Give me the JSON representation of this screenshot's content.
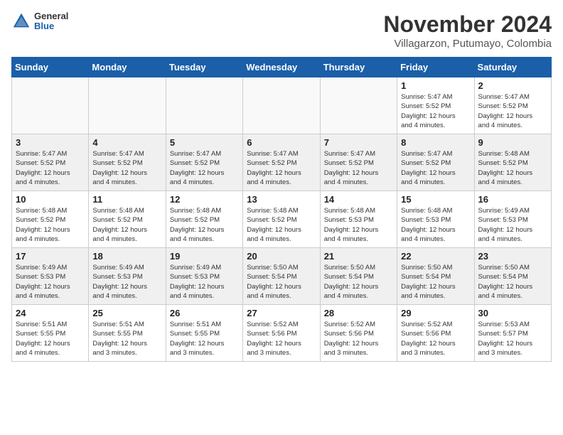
{
  "header": {
    "logo": {
      "general": "General",
      "blue": "Blue"
    },
    "title": "November 2024",
    "subtitle": "Villagarzon, Putumayo, Colombia"
  },
  "days_of_week": [
    "Sunday",
    "Monday",
    "Tuesday",
    "Wednesday",
    "Thursday",
    "Friday",
    "Saturday"
  ],
  "weeks": [
    {
      "days": [
        {
          "num": "",
          "info": "",
          "empty": true
        },
        {
          "num": "",
          "info": "",
          "empty": true
        },
        {
          "num": "",
          "info": "",
          "empty": true
        },
        {
          "num": "",
          "info": "",
          "empty": true
        },
        {
          "num": "",
          "info": "",
          "empty": true
        },
        {
          "num": "1",
          "info": "Sunrise: 5:47 AM\nSunset: 5:52 PM\nDaylight: 12 hours\nand 4 minutes."
        },
        {
          "num": "2",
          "info": "Sunrise: 5:47 AM\nSunset: 5:52 PM\nDaylight: 12 hours\nand 4 minutes."
        }
      ]
    },
    {
      "days": [
        {
          "num": "3",
          "info": "Sunrise: 5:47 AM\nSunset: 5:52 PM\nDaylight: 12 hours\nand 4 minutes."
        },
        {
          "num": "4",
          "info": "Sunrise: 5:47 AM\nSunset: 5:52 PM\nDaylight: 12 hours\nand 4 minutes."
        },
        {
          "num": "5",
          "info": "Sunrise: 5:47 AM\nSunset: 5:52 PM\nDaylight: 12 hours\nand 4 minutes."
        },
        {
          "num": "6",
          "info": "Sunrise: 5:47 AM\nSunset: 5:52 PM\nDaylight: 12 hours\nand 4 minutes."
        },
        {
          "num": "7",
          "info": "Sunrise: 5:47 AM\nSunset: 5:52 PM\nDaylight: 12 hours\nand 4 minutes."
        },
        {
          "num": "8",
          "info": "Sunrise: 5:47 AM\nSunset: 5:52 PM\nDaylight: 12 hours\nand 4 minutes."
        },
        {
          "num": "9",
          "info": "Sunrise: 5:48 AM\nSunset: 5:52 PM\nDaylight: 12 hours\nand 4 minutes."
        }
      ]
    },
    {
      "days": [
        {
          "num": "10",
          "info": "Sunrise: 5:48 AM\nSunset: 5:52 PM\nDaylight: 12 hours\nand 4 minutes."
        },
        {
          "num": "11",
          "info": "Sunrise: 5:48 AM\nSunset: 5:52 PM\nDaylight: 12 hours\nand 4 minutes."
        },
        {
          "num": "12",
          "info": "Sunrise: 5:48 AM\nSunset: 5:52 PM\nDaylight: 12 hours\nand 4 minutes."
        },
        {
          "num": "13",
          "info": "Sunrise: 5:48 AM\nSunset: 5:52 PM\nDaylight: 12 hours\nand 4 minutes."
        },
        {
          "num": "14",
          "info": "Sunrise: 5:48 AM\nSunset: 5:53 PM\nDaylight: 12 hours\nand 4 minutes."
        },
        {
          "num": "15",
          "info": "Sunrise: 5:48 AM\nSunset: 5:53 PM\nDaylight: 12 hours\nand 4 minutes."
        },
        {
          "num": "16",
          "info": "Sunrise: 5:49 AM\nSunset: 5:53 PM\nDaylight: 12 hours\nand 4 minutes."
        }
      ]
    },
    {
      "days": [
        {
          "num": "17",
          "info": "Sunrise: 5:49 AM\nSunset: 5:53 PM\nDaylight: 12 hours\nand 4 minutes."
        },
        {
          "num": "18",
          "info": "Sunrise: 5:49 AM\nSunset: 5:53 PM\nDaylight: 12 hours\nand 4 minutes."
        },
        {
          "num": "19",
          "info": "Sunrise: 5:49 AM\nSunset: 5:53 PM\nDaylight: 12 hours\nand 4 minutes."
        },
        {
          "num": "20",
          "info": "Sunrise: 5:50 AM\nSunset: 5:54 PM\nDaylight: 12 hours\nand 4 minutes."
        },
        {
          "num": "21",
          "info": "Sunrise: 5:50 AM\nSunset: 5:54 PM\nDaylight: 12 hours\nand 4 minutes."
        },
        {
          "num": "22",
          "info": "Sunrise: 5:50 AM\nSunset: 5:54 PM\nDaylight: 12 hours\nand 4 minutes."
        },
        {
          "num": "23",
          "info": "Sunrise: 5:50 AM\nSunset: 5:54 PM\nDaylight: 12 hours\nand 4 minutes."
        }
      ]
    },
    {
      "days": [
        {
          "num": "24",
          "info": "Sunrise: 5:51 AM\nSunset: 5:55 PM\nDaylight: 12 hours\nand 4 minutes."
        },
        {
          "num": "25",
          "info": "Sunrise: 5:51 AM\nSunset: 5:55 PM\nDaylight: 12 hours\nand 3 minutes."
        },
        {
          "num": "26",
          "info": "Sunrise: 5:51 AM\nSunset: 5:55 PM\nDaylight: 12 hours\nand 3 minutes."
        },
        {
          "num": "27",
          "info": "Sunrise: 5:52 AM\nSunset: 5:56 PM\nDaylight: 12 hours\nand 3 minutes."
        },
        {
          "num": "28",
          "info": "Sunrise: 5:52 AM\nSunset: 5:56 PM\nDaylight: 12 hours\nand 3 minutes."
        },
        {
          "num": "29",
          "info": "Sunrise: 5:52 AM\nSunset: 5:56 PM\nDaylight: 12 hours\nand 3 minutes."
        },
        {
          "num": "30",
          "info": "Sunrise: 5:53 AM\nSunset: 5:57 PM\nDaylight: 12 hours\nand 3 minutes."
        }
      ]
    }
  ]
}
